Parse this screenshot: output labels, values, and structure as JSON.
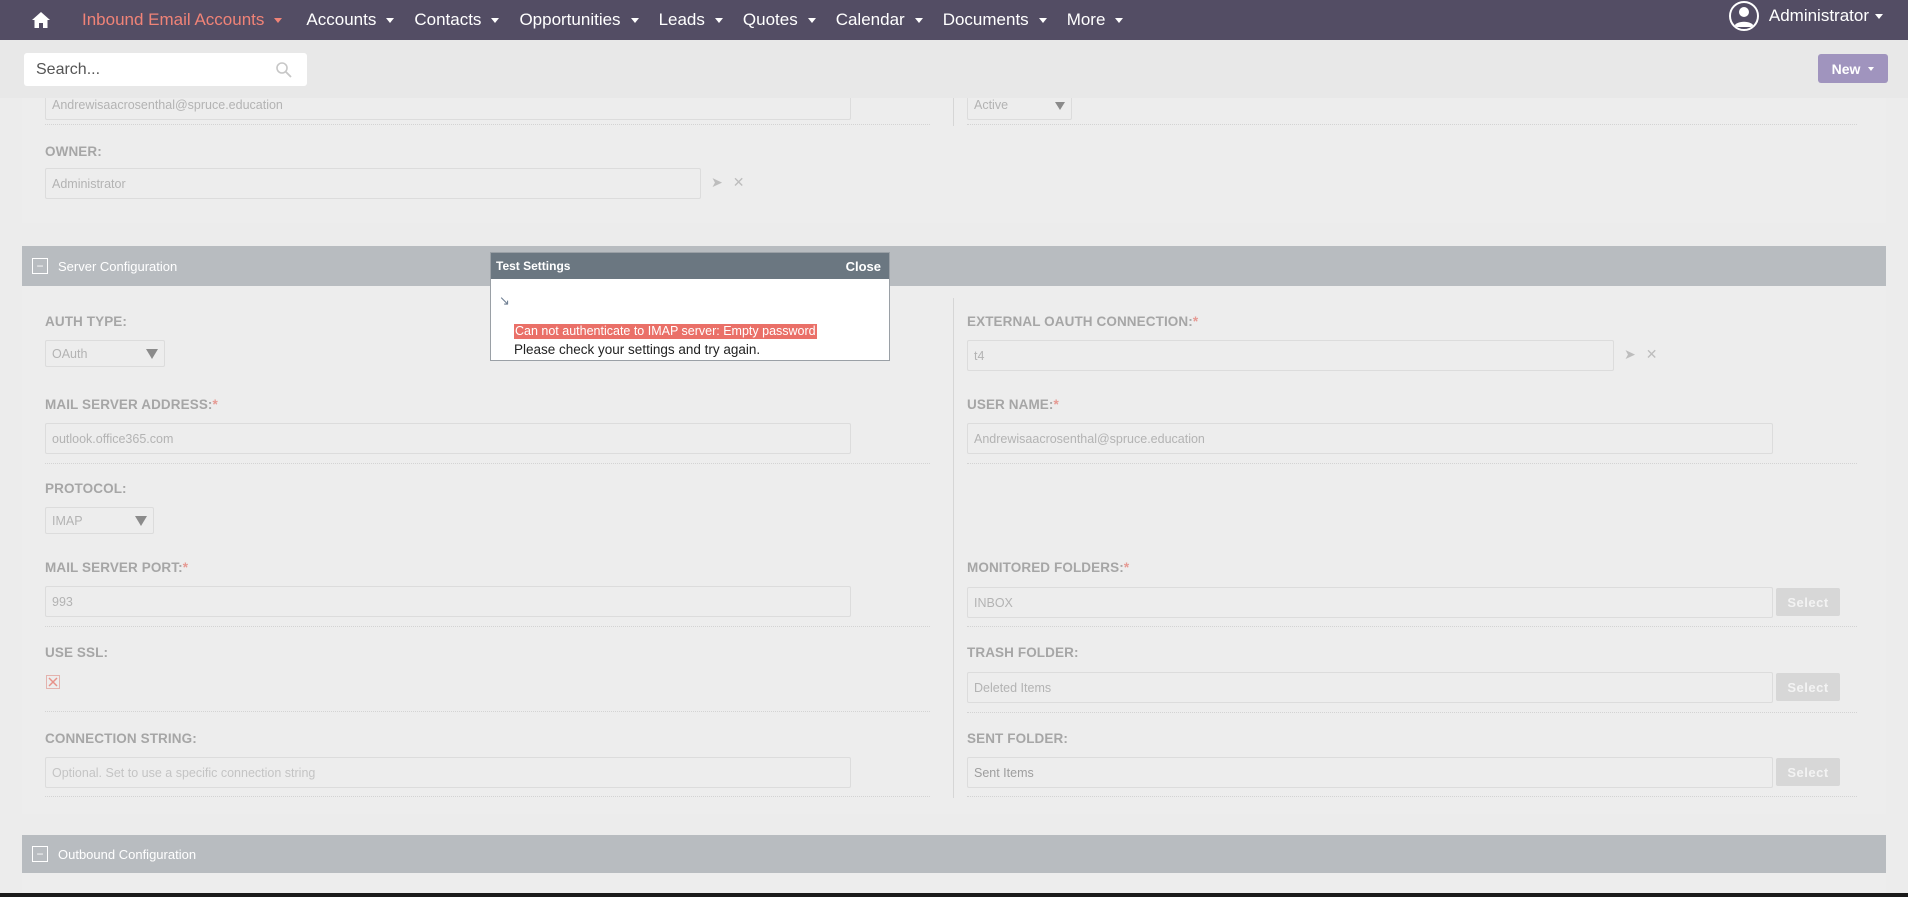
{
  "nav": {
    "items": [
      {
        "label": "Inbound Email Accounts",
        "active": true
      },
      {
        "label": "Accounts"
      },
      {
        "label": "Contacts"
      },
      {
        "label": "Opportunities"
      },
      {
        "label": "Leads"
      },
      {
        "label": "Quotes"
      },
      {
        "label": "Calendar"
      },
      {
        "label": "Documents"
      },
      {
        "label": "More"
      }
    ],
    "user": "Administrator"
  },
  "search": {
    "placeholder": "Search..."
  },
  "new_button": "New",
  "top_section": {
    "email_value": "Andrewisaacrosenthal@spruce.education",
    "status_value": "Active",
    "owner_label": "OWNER:",
    "owner_value": "Administrator"
  },
  "server_config": {
    "title": "Server Configuration",
    "auth_type_label": "AUTH TYPE:",
    "auth_type_value": "OAuth",
    "external_oauth_label": "EXTERNAL OAUTH CONNECTION:",
    "external_oauth_value": "t4",
    "mail_server_address_label": "MAIL SERVER ADDRESS:",
    "mail_server_address_value": "outlook.office365.com",
    "user_name_label": "USER NAME:",
    "user_name_value": "Andrewisaacrosenthal@spruce.education",
    "protocol_label": "PROTOCOL:",
    "protocol_value": "IMAP",
    "mail_server_port_label": "MAIL SERVER PORT:",
    "mail_server_port_value": "993",
    "monitored_folders_label": "MONITORED FOLDERS:",
    "monitored_folders_value": "INBOX",
    "use_ssl_label": "USE SSL:",
    "trash_folder_label": "TRASH FOLDER:",
    "trash_folder_value": "Deleted Items",
    "connection_string_label": "CONNECTION STRING:",
    "connection_string_placeholder": "Optional. Set to use a specific connection string",
    "sent_folder_label": "SENT FOLDER:",
    "sent_folder_value": "Sent Items",
    "select_label": "Select",
    "required_mark": "*"
  },
  "outbound_config": {
    "title": "Outbound Configuration"
  },
  "dialog": {
    "title": "Test Settings",
    "close_label": "Close",
    "error_text": "Can not authenticate to IMAP server: Empty password",
    "message": "Please check your settings and try again."
  }
}
